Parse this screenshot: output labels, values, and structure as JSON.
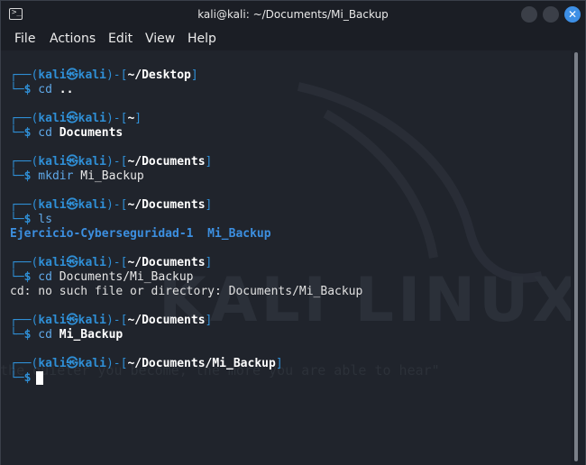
{
  "window": {
    "title": "kali@kali: ~/Documents/Mi_Backup",
    "app_icon_glyph": ">_",
    "close_glyph": "✕"
  },
  "menu": {
    "items": [
      "File",
      "Actions",
      "Edit",
      "View",
      "Help"
    ]
  },
  "terminal": {
    "prompt_user": "kali",
    "prompt_at": "㉿",
    "prompt_host": "kali",
    "prompt_symbol": "$",
    "blocks": [
      {
        "path": "~/Desktop",
        "cmd": "cd",
        "arg": "..",
        "output": []
      },
      {
        "path": "~",
        "cmd": "cd",
        "arg": "Documents",
        "output": []
      },
      {
        "path": "~/Documents",
        "cmd": "mkdir",
        "arg": "Mi_Backup",
        "output": []
      },
      {
        "path": "~/Documents",
        "cmd": "ls",
        "arg": "",
        "output": [
          "Ejercicio-Cyberseguridad-1  Mi_Backup"
        ]
      },
      {
        "path": "~/Documents",
        "cmd": "cd",
        "arg": "Documents/Mi_Backup",
        "output": [
          "cd: no such file or directory: Documents/Mi_Backup"
        ]
      },
      {
        "path": "~/Documents",
        "cmd": "cd",
        "arg": "Mi_Backup",
        "output": []
      },
      {
        "path": "~/Documents/Mi_Backup",
        "cmd": "",
        "arg": "",
        "output": []
      }
    ],
    "watermark_text": "KALI LINUX",
    "watermark_quote": "\"the quieter you become, the more you are able to hear\""
  },
  "colors": {
    "prompt_frame": "#2f8fd6",
    "directory_listing": "#3c8fe0",
    "background": "#20242c",
    "close_button": "#3d8fe6"
  }
}
